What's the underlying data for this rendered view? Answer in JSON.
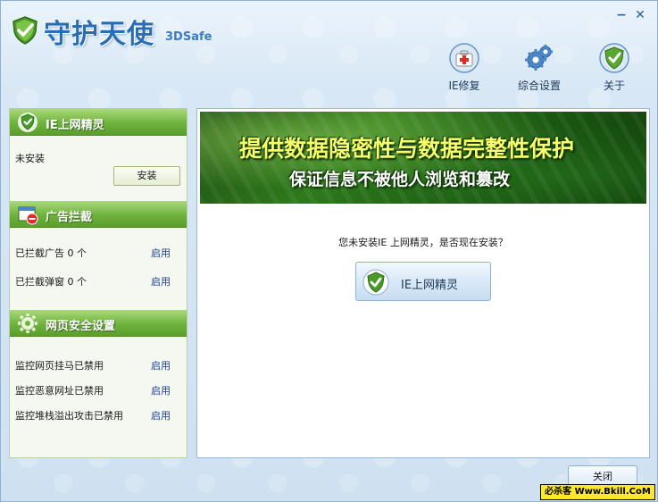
{
  "app": {
    "title": "守护天使",
    "subtitle": "3DSafe",
    "minimize_label": "−",
    "close_label": "✕"
  },
  "toolbar": {
    "items": [
      {
        "label": "IE修复",
        "icon": "first-aid-kit-icon"
      },
      {
        "label": "综合设置",
        "icon": "gears-icon"
      },
      {
        "label": "关于",
        "icon": "shield-check-icon"
      }
    ]
  },
  "sidebar": {
    "sections": [
      {
        "title": "IE上网精灵",
        "icon": "shield-check-icon",
        "status": "未安装",
        "install_label": "安装"
      },
      {
        "title": "广告拦截",
        "icon": "ad-block-window-icon",
        "rows": [
          {
            "text": "已拦截广告 0 个",
            "action": "启用"
          },
          {
            "text": "已拦截弹窗 0 个",
            "action": "启用"
          }
        ]
      },
      {
        "title": "网页安全设置",
        "icon": "gear-icon",
        "rows": [
          {
            "text": "监控网页挂马已禁用",
            "action": "启用"
          },
          {
            "text": "监控恶意网址已禁用",
            "action": "启用"
          },
          {
            "text": "监控堆栈溢出攻击已禁用",
            "action": "启用"
          }
        ]
      }
    ]
  },
  "main": {
    "banner_line1": "提供数据隐密性与数据完整性保护",
    "banner_line2": "保证信息不被他人浏览和篡改",
    "prompt": "您未安装IE 上网精灵，是否现在安装？",
    "install_button_label": "IE上网精灵"
  },
  "footer": {
    "close_label": "关闭",
    "watermark": "必杀客 Www.Bkill.CoM"
  },
  "colors": {
    "section_header_green": "#6fb23e",
    "banner_green": "#2f7a1c",
    "banner_yellow_text": "#f6ff6a",
    "title_blue": "#2b6db4",
    "link_blue": "#1b3f8f"
  }
}
